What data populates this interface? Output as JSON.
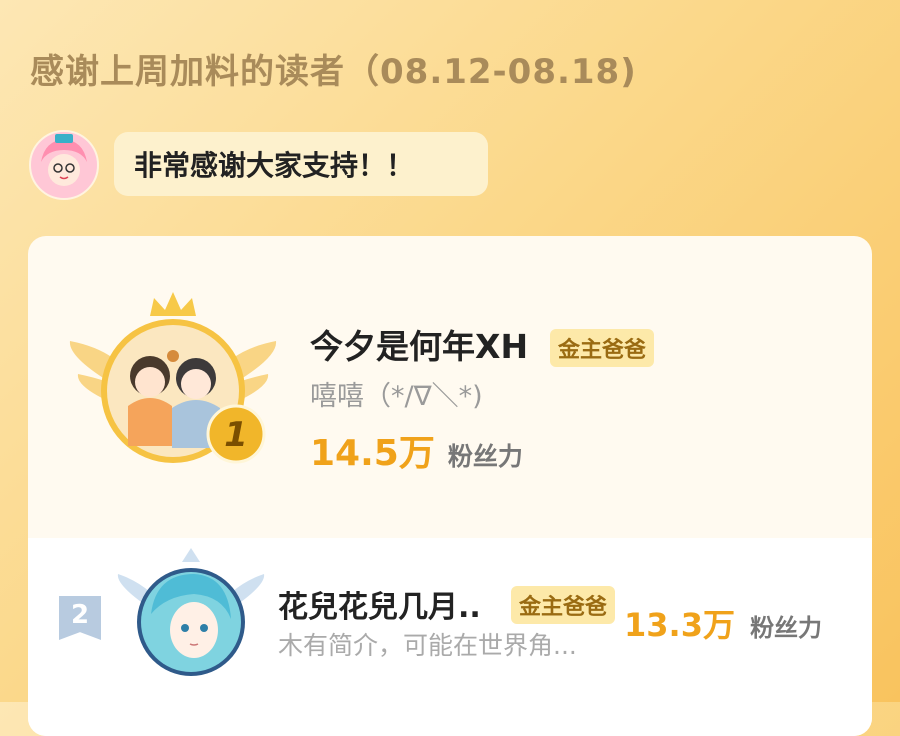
{
  "header": {
    "title": "感谢上周加料的读者（08.12-08.18)"
  },
  "author": {
    "message": "非常感谢大家支持！！"
  },
  "ranking": [
    {
      "rank": "1",
      "name": "今夕是何年XH",
      "badge": "金主爸爸",
      "bio": "嘻嘻（*/∇＼*)",
      "fans_value": "14.5万",
      "fans_label": "粉丝力"
    },
    {
      "rank": "2",
      "name": "花兒花兒几月..",
      "badge": "金主爸爸",
      "bio": "木有简介，可能在世界角...",
      "fans_value": "13.3万",
      "fans_label": "粉丝力"
    }
  ],
  "colors": {
    "accent": "#f0a21a",
    "gold": "#f6c343",
    "badge_bg": "#fde9a9",
    "silver": "#b8cbe0"
  },
  "icons": [
    "crown-icon",
    "wings-icon",
    "rank-medal-icon",
    "rank-ribbon-icon"
  ]
}
